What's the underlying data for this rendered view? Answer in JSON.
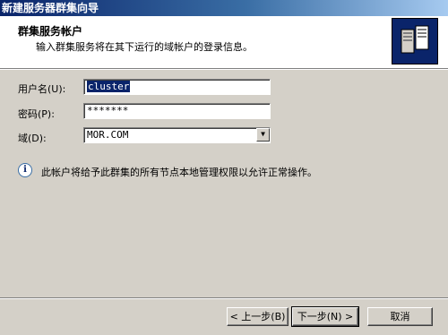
{
  "window": {
    "title": "新建服务器群集向导"
  },
  "header": {
    "title": "群集服务帐户",
    "subtitle": "输入群集服务将在其下运行的域帐户的登录信息。",
    "icon": "server-cluster-icon"
  },
  "form": {
    "username": {
      "label": "用户名(U):",
      "value": "cluster"
    },
    "password": {
      "label": "密码(P):",
      "value": "*******"
    },
    "domain": {
      "label": "域(D):",
      "value": "MOR.COM"
    }
  },
  "info": {
    "icon": "info-icon",
    "text": "此帐户将给予此群集的所有节点本地管理权限以允许正常操作。"
  },
  "buttons": {
    "back": "< 上一步(B)",
    "next": "下一步(N) >",
    "cancel": "取消"
  },
  "colors": {
    "title_bar": "#0a246a",
    "dialog_bg": "#d4d0c8",
    "header_bg": "#ffffff"
  }
}
